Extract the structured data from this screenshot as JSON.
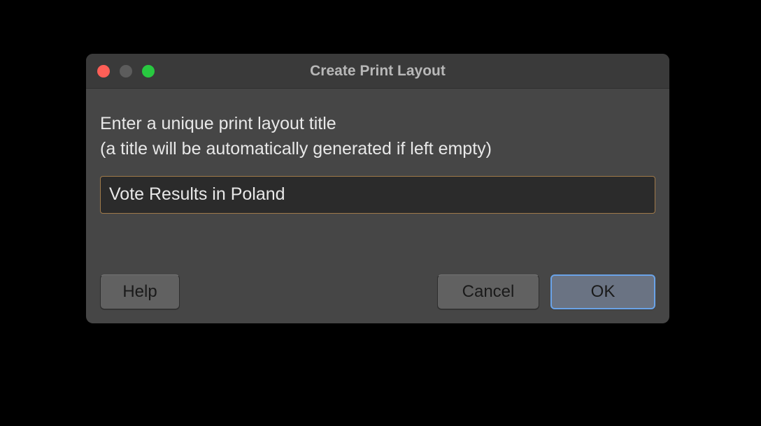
{
  "dialog": {
    "title": "Create Print Layout",
    "prompt_line1": "Enter a unique print layout title",
    "prompt_line2": "(a title will be automatically generated if left empty)",
    "input_value": "Vote Results in Poland",
    "buttons": {
      "help": "Help",
      "cancel": "Cancel",
      "ok": "OK"
    }
  }
}
